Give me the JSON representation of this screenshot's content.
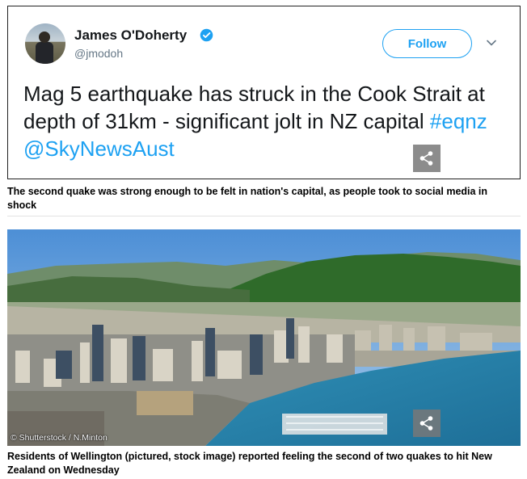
{
  "tweet": {
    "author_name": "James O'Doherty",
    "handle": "@jmodoh",
    "follow_label": "Follow",
    "text_plain": "Mag 5 earthquake has struck in the Cook Strait at depth of 31km - significant jolt in NZ capital ",
    "hashtag": "#eqnz",
    "mention": "@SkyNewsAust"
  },
  "captions": {
    "tweet_caption": "The second quake was strong enough to be felt in nation's capital, as people took to social media in shock",
    "photo_caption": "Residents of Wellington (pictured, stock image) reported feeling the second of two quakes to hit New Zealand on Wednesday"
  },
  "photo": {
    "credit": "© Shutterstock / N.Minton"
  },
  "icons": {
    "verified": "verified-badge-icon",
    "chevron": "chevron-down-icon",
    "share": "share-icon"
  },
  "colors": {
    "twitter_blue": "#1da1f2",
    "text_dark": "#14171a",
    "text_muted": "#657786"
  }
}
